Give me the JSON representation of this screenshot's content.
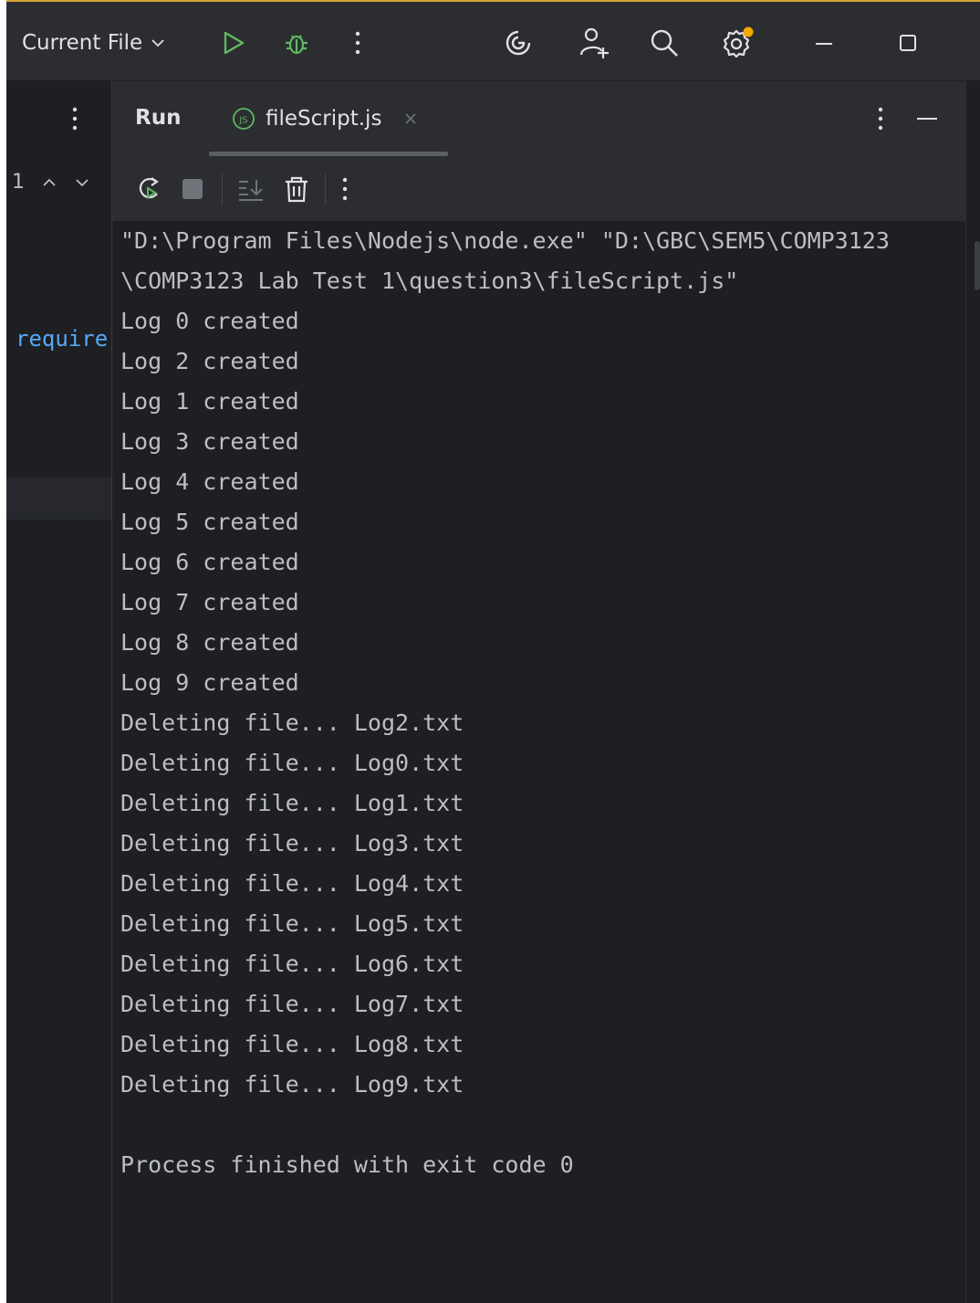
{
  "toolbar": {
    "run_config_label": "Current File",
    "icons": [
      "chevron-down-icon",
      "run-icon",
      "debug-icon",
      "more-vertical-icon",
      "ai-assistant-icon",
      "add-user-icon",
      "search-icon",
      "settings-icon",
      "minimize-icon",
      "maximize-icon"
    ]
  },
  "left_strip": {
    "nav_count": "1",
    "code_fragment": "require"
  },
  "run_panel": {
    "title": "Run",
    "tab_label": "fileScript.js",
    "tab_icon_text": "JS"
  },
  "console": {
    "lines": [
      "\"D:\\Program Files\\Nodejs\\node.exe\" \"D:\\GBC\\SEM5\\COMP3123",
      "\\COMP3123 Lab Test 1\\question3\\fileScript.js\"",
      "Log 0 created",
      "Log 2 created",
      "Log 1 created",
      "Log 3 created",
      "Log 4 created",
      "Log 5 created",
      "Log 6 created",
      "Log 7 created",
      "Log 8 created",
      "Log 9 created",
      "Deleting file... Log2.txt",
      "Deleting file... Log0.txt",
      "Deleting file... Log1.txt",
      "Deleting file... Log3.txt",
      "Deleting file... Log4.txt",
      "Deleting file... Log5.txt",
      "Deleting file... Log6.txt",
      "Deleting file... Log7.txt",
      "Deleting file... Log8.txt",
      "Deleting file... Log9.txt",
      "",
      "Process finished with exit code 0"
    ]
  },
  "colors": {
    "background": "#1e1f22",
    "toolbar": "#2b2d30",
    "run_green": "#5fb865",
    "accent_orange": "#f2a900",
    "code_blue": "#56a8f5"
  }
}
